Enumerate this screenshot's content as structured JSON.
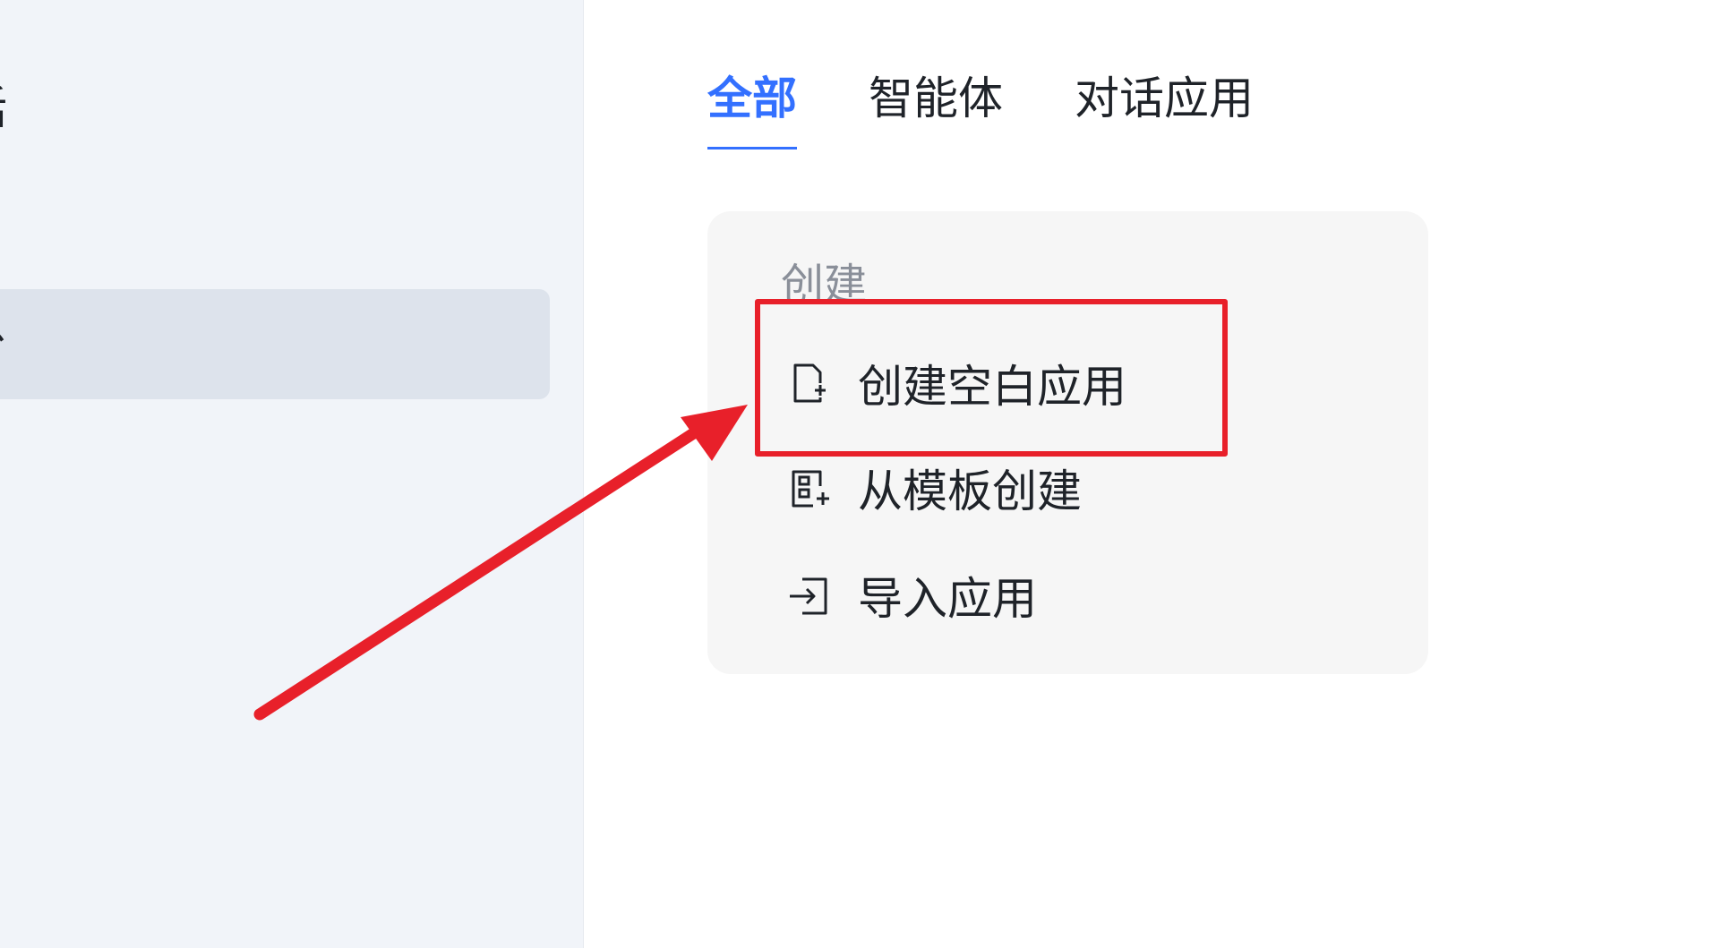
{
  "sidebar": {
    "items": [
      {
        "label": "话"
      },
      {
        "label": "台"
      }
    ]
  },
  "tabs": [
    {
      "label": "全部"
    },
    {
      "label": "智能体"
    },
    {
      "label": "对话应用"
    }
  ],
  "create_panel": {
    "heading": "创建",
    "items": [
      {
        "label": "创建空白应用",
        "icon": "file-add-icon"
      },
      {
        "label": "从模板创建",
        "icon": "template-add-icon"
      },
      {
        "label": "导入应用",
        "icon": "import-icon"
      }
    ]
  },
  "colors": {
    "accent": "#3370ff",
    "annotation": "#e8202a",
    "sidebar_bg": "#f1f4f9",
    "sidebar_active": "#dde3ec",
    "panel_bg": "#f6f6f6"
  }
}
